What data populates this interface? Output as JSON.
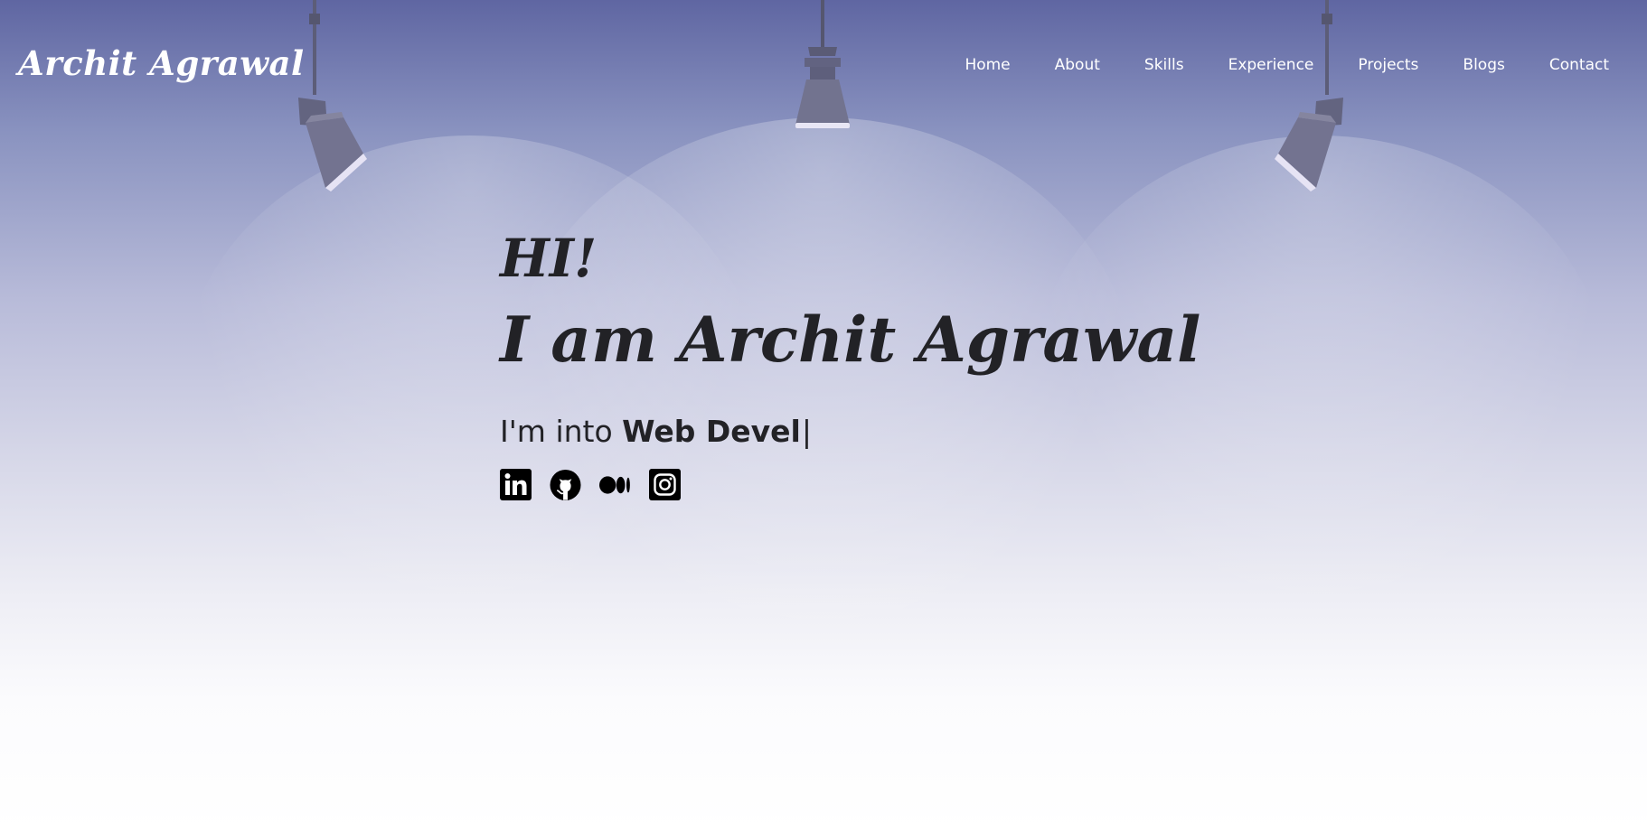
{
  "header": {
    "logo": "Archit Agrawal",
    "nav": [
      {
        "label": "Home"
      },
      {
        "label": "About"
      },
      {
        "label": "Skills"
      },
      {
        "label": "Experience"
      },
      {
        "label": "Projects"
      },
      {
        "label": "Blogs"
      },
      {
        "label": "Contact"
      }
    ]
  },
  "hero": {
    "greeting": "HI!",
    "intro": "I am Archit Agrawal",
    "tagline_prefix": "I'm into ",
    "tagline_highlight": "Web Devel",
    "cursor": "|",
    "socials": [
      {
        "icon": "linkedin-icon"
      },
      {
        "icon": "github-icon"
      },
      {
        "icon": "medium-icon"
      },
      {
        "icon": "instagram-icon"
      }
    ]
  },
  "colors": {
    "background_top": "#5f66a2",
    "background_bottom": "#ffffff",
    "text_dark": "#222226",
    "nav_text": "#ffffff",
    "lamp": "#6f6f8e"
  }
}
